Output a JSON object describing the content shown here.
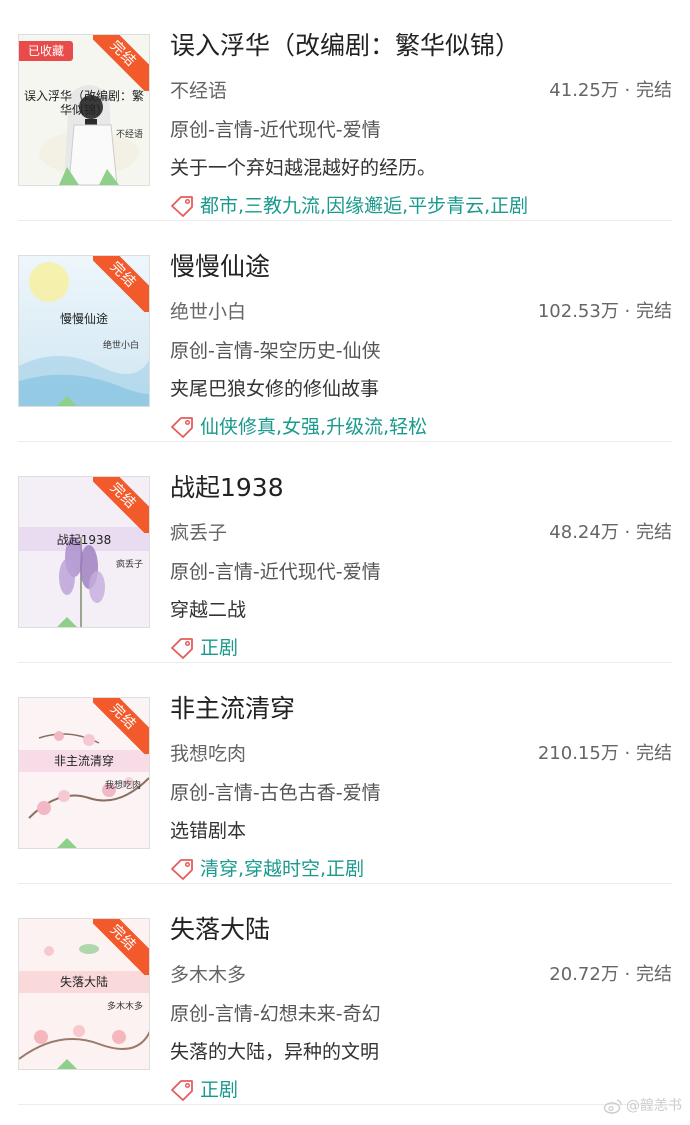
{
  "books": [
    {
      "cover_title": "误入浮华（改编剧：繁华似锦）",
      "cover_author": "不经语",
      "ribbon": "完结",
      "collected": "已收藏",
      "title": "误入浮华（改编剧：繁华似锦）",
      "author": "不经语",
      "stats": "41.25万 · 完结",
      "category": "原创-言情-近代现代-爱情",
      "desc": "关于一个弃妇越混越好的经历。",
      "tags": "都市,三教九流,因缘邂逅,平步青云,正剧"
    },
    {
      "cover_title": "慢慢仙途",
      "cover_author": "绝世小白",
      "ribbon": "完结",
      "title": "慢慢仙途",
      "author": "绝世小白",
      "stats": "102.53万 · 完结",
      "category": "原创-言情-架空历史-仙侠",
      "desc": "夹尾巴狼女修的修仙故事",
      "tags": "仙侠修真,女强,升级流,轻松"
    },
    {
      "cover_title": "战起1938",
      "cover_author": "疯丢子",
      "ribbon": "完结",
      "title": "战起1938",
      "author": "疯丢子",
      "stats": "48.24万 · 完结",
      "category": "原创-言情-近代现代-爱情",
      "desc": "穿越二战",
      "tags": "正剧"
    },
    {
      "cover_title": "非主流清穿",
      "cover_author": "我想吃肉",
      "ribbon": "完结",
      "title": "非主流清穿",
      "author": "我想吃肉",
      "stats": "210.15万 · 完结",
      "category": "原创-言情-古色古香-爱情",
      "desc": "选错剧本",
      "tags": "清穿,穿越时空,正剧"
    },
    {
      "cover_title": "失落大陆",
      "cover_author": "多木木多",
      "ribbon": "完结",
      "title": "失落大陆",
      "author": "多木木多",
      "stats": "20.72万 · 完结",
      "category": "原创-言情-幻想未来-奇幻",
      "desc": "失落的大陆，异种的文明",
      "tags": "正剧"
    }
  ],
  "watermark": "@韹恙书",
  "colors": {
    "ribbon": "#f25a2b",
    "collected_badge": "#e94b4b",
    "tag_text": "#1a9a8c",
    "tag_icon": "#e85b5b"
  },
  "icons": {
    "tag": "tag-icon",
    "weibo": "weibo-icon"
  }
}
